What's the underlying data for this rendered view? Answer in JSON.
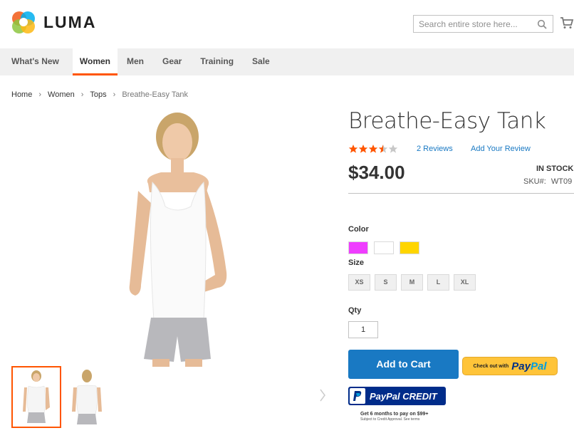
{
  "header": {
    "logo_text": "LUMA",
    "search_placeholder": "Search entire store here..."
  },
  "nav": {
    "items": [
      {
        "label": "What's New"
      },
      {
        "label": "Women",
        "active": true
      },
      {
        "label": "Men"
      },
      {
        "label": "Gear"
      },
      {
        "label": "Training"
      },
      {
        "label": "Sale"
      }
    ]
  },
  "breadcrumb": [
    "Home",
    "Women",
    "Tops",
    "Breathe-Easy Tank"
  ],
  "product": {
    "title": "Breathe-Easy Tank",
    "rating": 3.5,
    "rating_max": 5,
    "reviews_label": "2 Reviews",
    "add_review_label": "Add Your Review",
    "price": "$34.00",
    "stock": "IN STOCK",
    "sku_label": "SKU#:",
    "sku": "WT09",
    "color_label": "Color",
    "colors": [
      "#ef3dff",
      "#ffffff",
      "#ffd500"
    ],
    "size_label": "Size",
    "sizes": [
      "XS",
      "S",
      "M",
      "L",
      "XL"
    ],
    "qty_label": "Qty",
    "qty_value": "1",
    "add_to_cart_label": "Add to Cart"
  },
  "paypal": {
    "checkout_small": "Check out with",
    "brand_pay": "Pay",
    "brand_pal": "Pal",
    "credit_label": "PayPal CREDIT",
    "credit_note": "Get 6 months to pay on $99+",
    "credit_sub": "Subject to Credit Approval. See terms"
  },
  "colors": {
    "accent": "#ff5501",
    "link": "#1979c3",
    "button": "#1979c3",
    "star": "#ff5501"
  }
}
